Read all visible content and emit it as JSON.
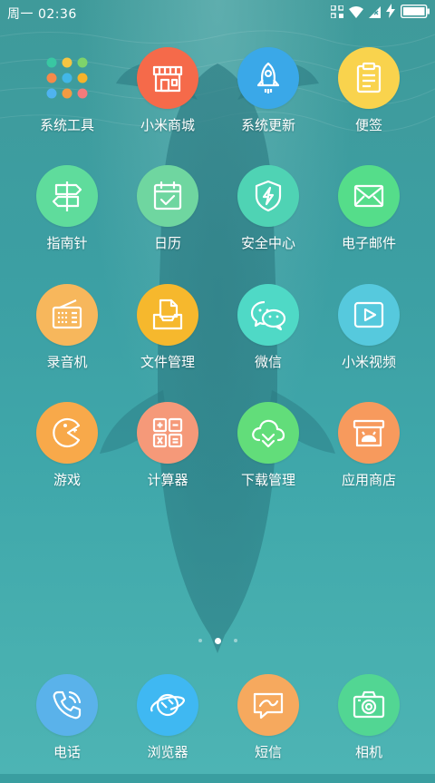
{
  "status_bar": {
    "time": "周一 02:36",
    "icons": [
      "grid-icon",
      "wifi-icon",
      "sim-off-icon",
      "charging-icon",
      "battery-icon"
    ]
  },
  "apps": [
    {
      "name": "system-tools",
      "label": "系统工具",
      "icon": "folder-icon",
      "color": "folder"
    },
    {
      "name": "mi-store",
      "label": "小米商城",
      "icon": "store-icon",
      "color": "#f56a4a"
    },
    {
      "name": "system-update",
      "label": "系统更新",
      "icon": "rocket-icon",
      "color": "#3aa8e8"
    },
    {
      "name": "notes",
      "label": "便签",
      "icon": "notepad-icon",
      "color": "#f9d34d"
    },
    {
      "name": "compass",
      "label": "指南针",
      "icon": "signpost-icon",
      "color": "#5fdc9c"
    },
    {
      "name": "calendar",
      "label": "日历",
      "icon": "calendar-icon",
      "color": "#6fd6a0"
    },
    {
      "name": "security",
      "label": "安全中心",
      "icon": "shield-icon",
      "color": "#4fd3b4"
    },
    {
      "name": "email",
      "label": "电子邮件",
      "icon": "envelope-icon",
      "color": "#55dd8a"
    },
    {
      "name": "recorder",
      "label": "录音机",
      "icon": "radio-icon",
      "color": "#f7b75c"
    },
    {
      "name": "file-manager",
      "label": "文件管理",
      "icon": "file-tray-icon",
      "color": "#f6b82d"
    },
    {
      "name": "wechat",
      "label": "微信",
      "icon": "wechat-icon",
      "color": "#4fd9c6"
    },
    {
      "name": "mi-video",
      "label": "小米视频",
      "icon": "play-icon",
      "color": "#56c9dd"
    },
    {
      "name": "games",
      "label": "游戏",
      "icon": "pacman-icon",
      "color": "#f8a94a"
    },
    {
      "name": "calculator",
      "label": "计算器",
      "icon": "calculator-icon",
      "color": "#f59979"
    },
    {
      "name": "download-manager",
      "label": "下载管理",
      "icon": "cloud-download-icon",
      "color": "#62dd7a"
    },
    {
      "name": "app-store",
      "label": "应用商店",
      "icon": "android-store-icon",
      "color": "#f79a5d"
    }
  ],
  "dock": [
    {
      "name": "phone",
      "label": "电话",
      "icon": "phone-icon",
      "color": "#5ab2ea"
    },
    {
      "name": "browser",
      "label": "浏览器",
      "icon": "planet-icon",
      "color": "#3fb8f2"
    },
    {
      "name": "messages",
      "label": "短信",
      "icon": "message-icon",
      "color": "#f6a95e"
    },
    {
      "name": "camera",
      "label": "相机",
      "icon": "camera-icon",
      "color": "#52d693"
    }
  ],
  "pager": {
    "page_count": 3,
    "current_page": 2
  }
}
